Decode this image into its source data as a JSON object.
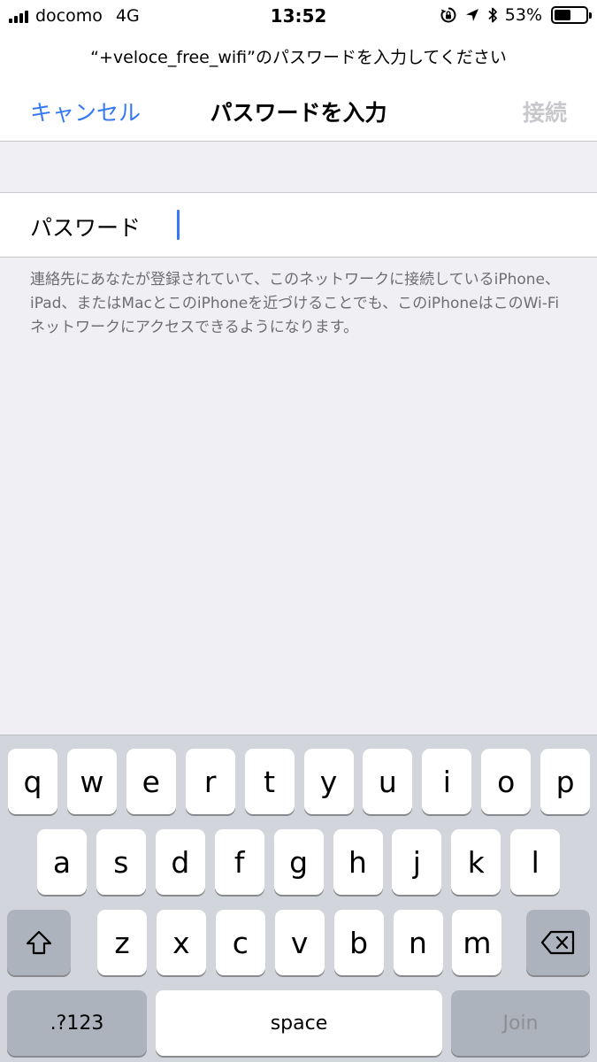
{
  "status_bar": {
    "carrier": "docomo",
    "network": "4G",
    "time": "13:52",
    "battery_percent": "53%",
    "battery_level": 0.53
  },
  "header": {
    "prompt": "“+veloce_free_wifi”のパスワードを入力してください",
    "cancel_label": "キャンセル",
    "title": "パスワードを入力",
    "join_label": "接続"
  },
  "password_field": {
    "label": "パスワード",
    "value": ""
  },
  "note": "連絡先にあなたが登録されていて、このネットワークに接続しているiPhone、iPad、またはMacとこのiPhoneを近づけることでも、このiPhoneはこのWi-Fiネットワークにアクセスできるようになります。",
  "keyboard": {
    "row1": [
      "q",
      "w",
      "e",
      "r",
      "t",
      "y",
      "u",
      "i",
      "o",
      "p"
    ],
    "row2": [
      "a",
      "s",
      "d",
      "f",
      "g",
      "h",
      "j",
      "k",
      "l"
    ],
    "row3": [
      "z",
      "x",
      "c",
      "v",
      "b",
      "n",
      "m"
    ],
    "shift_icon": "shift-icon",
    "delete_icon": "delete-icon",
    "numbers_label": ".?123",
    "space_label": "space",
    "join_label": "Join"
  },
  "colors": {
    "accent": "#3478f6",
    "disabled": "#c7c7cc",
    "background": "#efeff4",
    "keyboard_bg": "#d2d5db"
  }
}
